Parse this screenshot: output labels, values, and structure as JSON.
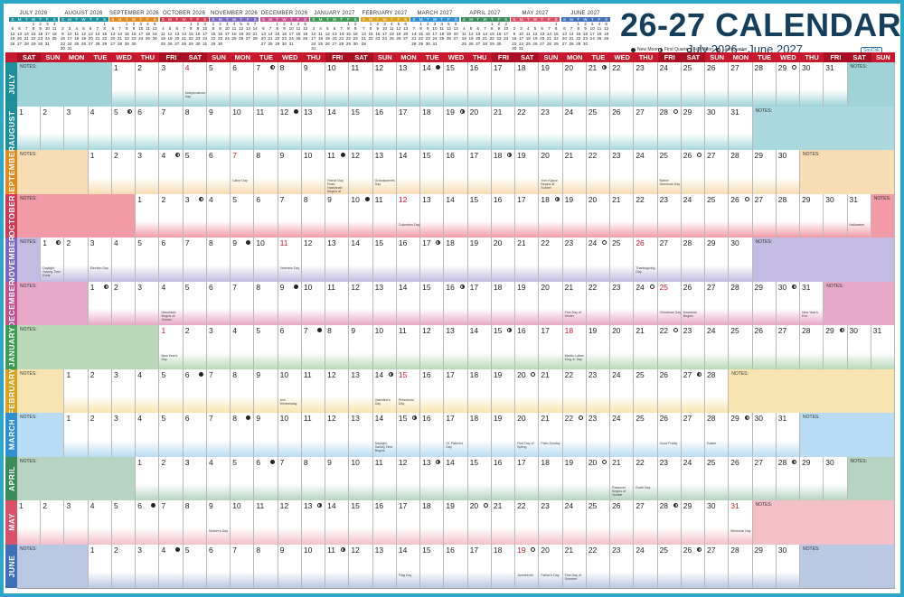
{
  "header": {
    "title": "26-27 CALENDAR",
    "subtitle": "July 2026 - June 2027",
    "brand": "SouCok",
    "legend": [
      {
        "phase": "new",
        "label": "New Moon"
      },
      {
        "phase": "fq",
        "label": "First Quarter"
      },
      {
        "phase": "full",
        "label": "Full Moon"
      },
      {
        "phase": "lq",
        "label": "Last Quarter"
      }
    ]
  },
  "weekday_header": [
    "SUN",
    "MON",
    "TUE",
    "WED",
    "THU",
    "FRI",
    "SAT"
  ],
  "mini_weekdays": [
    "S",
    "M",
    "T",
    "W",
    "T",
    "F",
    "S"
  ],
  "notes_label": "NOTES:",
  "colors": {
    "accent_red": "#c7182e",
    "frame": "#2aa7c9",
    "title": "#153d5c"
  },
  "months": [
    {
      "name": "JULY",
      "mini_title": "JULY 2026",
      "year": 2026,
      "month": 7,
      "days": 31,
      "start": 3,
      "color": "#9fd3d8",
      "label": "#1b8f9a",
      "moons": {
        "7": "lq",
        "14": "new",
        "21": "fq",
        "29": "full"
      },
      "events": {
        "4": "Independence Day"
      },
      "red": [
        4
      ]
    },
    {
      "name": "AUGUST",
      "mini_title": "AUGUST 2026",
      "year": 2026,
      "month": 8,
      "days": 31,
      "start": 6,
      "color": "#a9d9de",
      "label": "#1b8f9a",
      "moons": {
        "5": "lq",
        "12": "new",
        "19": "fq",
        "28": "full"
      },
      "events": {},
      "red": []
    },
    {
      "name": "SEPTEMBER",
      "mini_title": "SEPTEMBER 2026",
      "year": 2026,
      "month": 9,
      "days": 30,
      "start": 2,
      "color": "#f8dcb4",
      "label": "#e08a1e",
      "moons": {
        "4": "lq",
        "11": "new",
        "18": "fq",
        "26": "full"
      },
      "events": {
        "7": "Labor Day",
        "11": "Patriot Day Rosh Hashanah Begins at Sunset",
        "13": "Grandparents Day",
        "20": "Yom Kippur Begins at Sunset",
        "25": "Native American Day"
      },
      "red": [
        7
      ]
    },
    {
      "name": "OCTOBER",
      "mini_title": "OCTOBER 2026",
      "year": 2026,
      "month": 10,
      "days": 31,
      "start": 4,
      "color": "#f29aa6",
      "label": "#d23a52",
      "moons": {
        "3": "lq",
        "10": "new",
        "18": "fq",
        "26": "full"
      },
      "events": {
        "12": "Columbus Day",
        "31": "Halloween"
      },
      "red": [
        12
      ]
    },
    {
      "name": "NOVEMBER",
      "mini_title": "NOVEMBER 2026",
      "year": 2026,
      "month": 11,
      "days": 30,
      "start": 0,
      "color": "#c3bbe2",
      "label": "#7a67c0",
      "moons": {
        "1": "lq",
        "9": "new",
        "17": "fq",
        "24": "full"
      },
      "events": {
        "1": "Daylight Saving Time Ends",
        "3": "Election Day",
        "11": "Veterans Day",
        "26": "Thanksgiving Day"
      },
      "red": [
        11,
        26
      ]
    },
    {
      "name": "DECEMBER",
      "mini_title": "DECEMBER 2026",
      "year": 2026,
      "month": 12,
      "days": 31,
      "start": 2,
      "color": "#e8a9c9",
      "label": "#c2508e",
      "moons": {
        "1": "lq",
        "9": "new",
        "16": "fq",
        "24": "full",
        "30": "lq"
      },
      "events": {
        "4": "Hanukkah Begins at Sunset",
        "21": "First Day of Winter",
        "25": "Christmas Day",
        "26": "Kwanzaa Begins",
        "31": "New Year's Eve"
      },
      "red": [
        25
      ]
    },
    {
      "name": "JANUARY",
      "mini_title": "JANUARY 2027",
      "year": 2027,
      "month": 1,
      "days": 31,
      "start": 5,
      "color": "#b9d9b9",
      "label": "#3f9a55",
      "moons": {
        "7": "new",
        "15": "fq",
        "22": "full",
        "29": "lq"
      },
      "events": {
        "1": "New Year's Day",
        "18": "Martin Luther King Jr. Day"
      },
      "red": [
        1,
        18
      ]
    },
    {
      "name": "FEBRUARY",
      "mini_title": "FEBRUARY 2027",
      "year": 2027,
      "month": 2,
      "days": 28,
      "start": 1,
      "color": "#f7e4b0",
      "label": "#d9a21c",
      "moons": {
        "6": "new",
        "14": "fq",
        "20": "full",
        "27": "lq"
      },
      "events": {
        "10": "Ash Wednesday",
        "14": "Valentine's Day",
        "15": "Presidents' Day"
      },
      "red": [
        15
      ]
    },
    {
      "name": "MARCH",
      "mini_title": "MARCH 2027",
      "year": 2027,
      "month": 3,
      "days": 31,
      "start": 1,
      "color": "#b8dcf3",
      "label": "#2f8fd0",
      "moons": {
        "8": "new",
        "15": "fq",
        "22": "full",
        "29": "lq"
      },
      "events": {
        "14": "Daylight Saving Time Begins",
        "17": "St. Patrick's Day",
        "20": "First Day of Spring",
        "21": "Palm Sunday",
        "26": "Good Friday",
        "28": "Easter"
      },
      "red": []
    },
    {
      "name": "APRIL",
      "mini_title": "APRIL 2027",
      "year": 2027,
      "month": 4,
      "days": 30,
      "start": 4,
      "color": "#b7d3c1",
      "label": "#3b8a5a",
      "moons": {
        "6": "new",
        "13": "fq",
        "20": "full",
        "28": "lq"
      },
      "events": {
        "21": "Passover Begins at Sunset",
        "22": "Earth Day"
      },
      "red": []
    },
    {
      "name": "MAY",
      "mini_title": "MAY 2027",
      "year": 2027,
      "month": 5,
      "days": 31,
      "start": 6,
      "color": "#f5bfc8",
      "label": "#d9526a",
      "moons": {
        "6": "new",
        "13": "fq",
        "20": "full",
        "28": "lq"
      },
      "events": {
        "9": "Mother's Day",
        "31": "Memorial Day"
      },
      "red": [
        31
      ]
    },
    {
      "name": "JUNE",
      "mini_title": "JUNE 2027",
      "year": 2027,
      "month": 6,
      "days": 30,
      "start": 2,
      "color": "#b9c9e4",
      "label": "#3f6fb8",
      "moons": {
        "4": "new",
        "11": "fq",
        "19": "full",
        "26": "lq"
      },
      "events": {
        "14": "Flag Day",
        "19": "Juneteenth",
        "20": "Father's Day",
        "21": "First Day of Summer"
      },
      "red": [
        19
      ]
    }
  ]
}
